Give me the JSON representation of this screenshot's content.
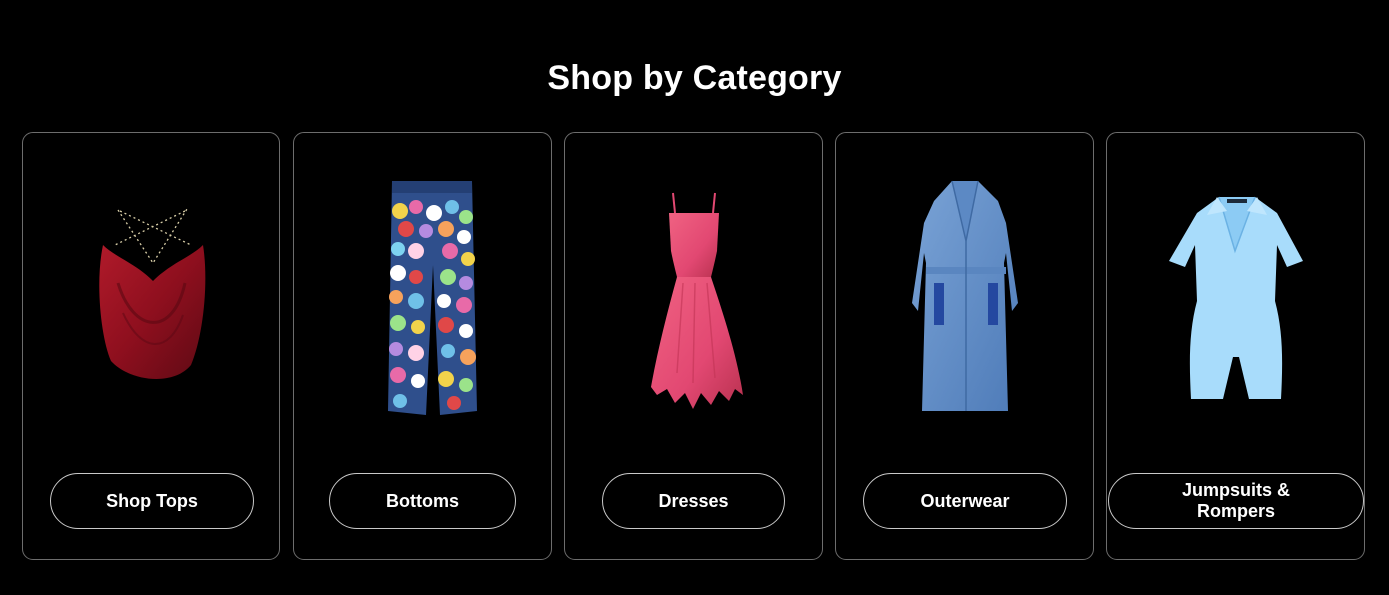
{
  "page": {
    "heading": "Shop by Category"
  },
  "categories": [
    {
      "label": "Shop Tops",
      "product": "red cowl-neck halter top"
    },
    {
      "label": "Bottoms",
      "product": "patchwork denim jeans"
    },
    {
      "label": "Dresses",
      "product": "pink handkerchief-hem dress"
    },
    {
      "label": "Outerwear",
      "product": "denim trench coat"
    },
    {
      "label": "Jumpsuits & Rompers",
      "product": "light blue collared romper"
    }
  ],
  "colors": {
    "background": "#000000",
    "text": "#ffffff",
    "card_border": "#6d6d6d",
    "button_border": "#c9c9c9"
  }
}
